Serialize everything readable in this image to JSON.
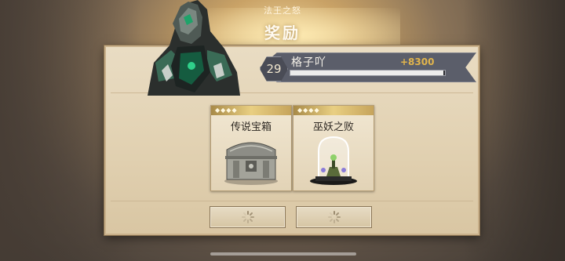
{
  "header": {
    "subtitle": "法王之怒",
    "title": "奖励"
  },
  "player": {
    "level": "29",
    "name": "格子吖",
    "exp_gain": "+8300",
    "xp_progress": 0.99
  },
  "rewards": [
    {
      "label": "传说宝箱",
      "pips": "◆◆◆◆",
      "icon": "treasure-chest-icon"
    },
    {
      "label": "巫妖之败",
      "pips": "◆◆◆◆",
      "icon": "bell-jar-icon"
    }
  ],
  "buttons": [
    {
      "state": "loading"
    },
    {
      "state": "loading"
    }
  ],
  "colors": {
    "accent_gold": "#e2b54c",
    "banner": "#5b5e6a",
    "parchment": "#e2d2b3"
  }
}
